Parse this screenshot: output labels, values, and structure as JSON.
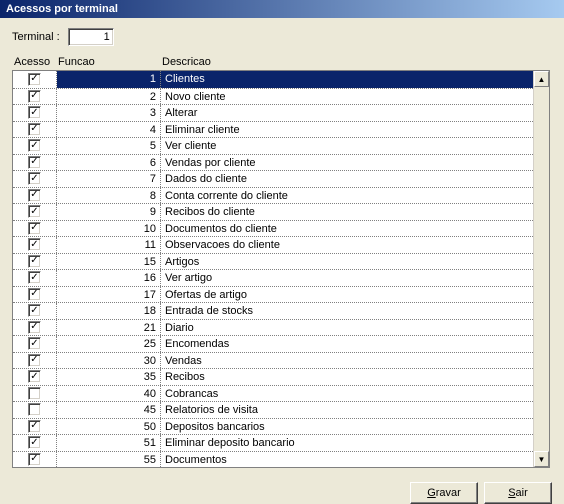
{
  "window": {
    "title": "Acessos por terminal"
  },
  "terminal": {
    "label": "Terminal :",
    "value": "1"
  },
  "headers": {
    "acesso": "Acesso",
    "funcao": "Funcao",
    "descricao": "Descricao"
  },
  "buttons": {
    "save_underline": "G",
    "save_rest": "ravar",
    "exit_underline": "S",
    "exit_rest": "air"
  },
  "checkmark": "✓",
  "icons": {
    "up": "▲",
    "down": "▼"
  },
  "rows": [
    {
      "checked": true,
      "funcao": "1",
      "descricao": "Clientes",
      "selected": true
    },
    {
      "checked": true,
      "funcao": "2",
      "descricao": "Novo cliente"
    },
    {
      "checked": true,
      "funcao": "3",
      "descricao": "Alterar"
    },
    {
      "checked": true,
      "funcao": "4",
      "descricao": "Eliminar cliente"
    },
    {
      "checked": true,
      "funcao": "5",
      "descricao": "Ver cliente"
    },
    {
      "checked": true,
      "funcao": "6",
      "descricao": "Vendas por cliente"
    },
    {
      "checked": true,
      "funcao": "7",
      "descricao": "Dados do cliente"
    },
    {
      "checked": true,
      "funcao": "8",
      "descricao": "Conta corrente do cliente"
    },
    {
      "checked": true,
      "funcao": "9",
      "descricao": "Recibos do cliente"
    },
    {
      "checked": true,
      "funcao": "10",
      "descricao": "Documentos do cliente"
    },
    {
      "checked": true,
      "funcao": "11",
      "descricao": "Observacoes do cliente"
    },
    {
      "checked": true,
      "funcao": "15",
      "descricao": "Artigos"
    },
    {
      "checked": true,
      "funcao": "16",
      "descricao": "Ver artigo"
    },
    {
      "checked": true,
      "funcao": "17",
      "descricao": "Ofertas de artigo"
    },
    {
      "checked": true,
      "funcao": "18",
      "descricao": "Entrada de stocks"
    },
    {
      "checked": true,
      "funcao": "21",
      "descricao": "Diario"
    },
    {
      "checked": true,
      "funcao": "25",
      "descricao": "Encomendas"
    },
    {
      "checked": true,
      "funcao": "30",
      "descricao": "Vendas"
    },
    {
      "checked": true,
      "funcao": "35",
      "descricao": "Recibos"
    },
    {
      "checked": false,
      "funcao": "40",
      "descricao": "Cobrancas"
    },
    {
      "checked": false,
      "funcao": "45",
      "descricao": "Relatorios de visita"
    },
    {
      "checked": true,
      "funcao": "50",
      "descricao": "Depositos bancarios"
    },
    {
      "checked": true,
      "funcao": "51",
      "descricao": "Eliminar deposito bancario"
    },
    {
      "checked": true,
      "funcao": "55",
      "descricao": "Documentos"
    }
  ]
}
